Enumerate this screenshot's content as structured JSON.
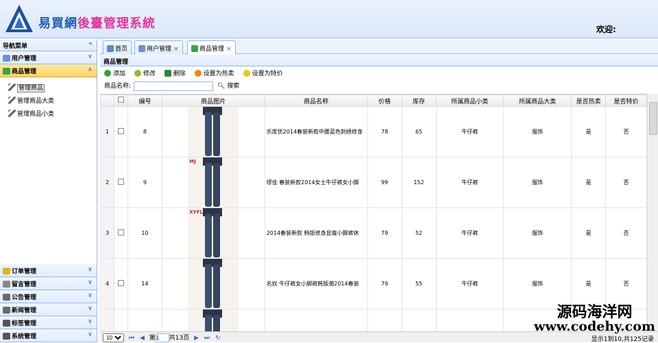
{
  "header": {
    "logo_text_blue": "易買網",
    "logo_text_pink": "後臺管理系統",
    "welcome": "欢迎:"
  },
  "sidebar": {
    "title": "导航菜单",
    "collapse_glyph": "«",
    "groups": [
      {
        "label": "用户管理",
        "icon": "user-icon",
        "color": "#6c8fd8"
      },
      {
        "label": "商品管理",
        "icon": "goods-icon",
        "color": "#3aa24a",
        "active": true
      }
    ],
    "leaves": [
      {
        "label": "管理商品",
        "icon": "wrench-icon",
        "selected": true
      },
      {
        "label": "管理商品大类",
        "icon": "wrench-icon"
      },
      {
        "label": "管理商品小类",
        "icon": "wrench-icon"
      }
    ],
    "bottom_groups": [
      {
        "label": "订单管理",
        "icon": "order-icon",
        "color": "#e0b224"
      },
      {
        "label": "留言管理",
        "icon": "message-icon",
        "color": "#888"
      },
      {
        "label": "公告管理",
        "icon": "notice-icon",
        "color": "#6a6a6a"
      },
      {
        "label": "新闻管理",
        "icon": "news-icon",
        "color": "#6a6a6a"
      },
      {
        "label": "标签管理",
        "icon": "tag-icon",
        "color": "#555"
      },
      {
        "label": "系统管理",
        "icon": "system-icon",
        "color": "#555"
      }
    ],
    "chevron": "∨"
  },
  "tabs": [
    {
      "label": "首页",
      "icon": "home-icon",
      "closable": false
    },
    {
      "label": "用户管理",
      "icon": "user-icon",
      "closable": true
    },
    {
      "label": "商品管理",
      "icon": "goods-icon",
      "closable": true,
      "active": true
    }
  ],
  "close_glyph": "×",
  "panel_title": "商品管理",
  "toolbar": [
    {
      "label": "添加",
      "icon": "add-icon",
      "color": "#35a33f"
    },
    {
      "label": "修改",
      "icon": "edit-icon",
      "color": "#8bbf33"
    },
    {
      "label": "删除",
      "icon": "delete-icon",
      "color": "#2f8a2f"
    },
    {
      "label": "设置为热卖",
      "icon": "fire-icon",
      "color": "#f08a10"
    },
    {
      "label": "设置为特价",
      "icon": "star-icon",
      "color": "#f2c40b"
    }
  ],
  "search": {
    "label": "商品名称:",
    "value": "",
    "button": "搜索"
  },
  "columns": [
    "",
    "编号",
    "商品图片",
    "商品名称",
    "价格",
    "库存",
    "所属商品小类",
    "所属商品大类",
    "是否热卖",
    "是否特价"
  ],
  "rows": [
    {
      "rn": "1",
      "id": "8",
      "tag": "",
      "name": "乐库优2014春装新款中腰蓝色刺绣修身",
      "price": "78",
      "stock": "65",
      "small": "牛仔裤",
      "big": "服饰",
      "hot": "是",
      "special": "否"
    },
    {
      "rn": "2",
      "id": "9",
      "tag": "MJ",
      "name": "缪佳 春装新款2014女士牛仔裤女小脚",
      "price": "99",
      "stock": "152",
      "small": "牛仔裤",
      "big": "服饰",
      "hot": "是",
      "special": "否"
    },
    {
      "rn": "3",
      "id": "10",
      "tag": "XYFL",
      "name": "2014春装新款 韩版修身显瘦小脚裤休",
      "price": "79",
      "stock": "52",
      "small": "牛仔裤",
      "big": "服饰",
      "hot": "是",
      "special": "否"
    },
    {
      "rn": "4",
      "id": "14",
      "tag": "",
      "name": "名奴 牛仔裤女小脚裤韩版潮2014春装",
      "price": "79",
      "stock": "55",
      "small": "牛仔裤",
      "big": "服饰",
      "hot": "是",
      "special": "否"
    },
    {
      "rn": "",
      "id": "",
      "tag": "",
      "name": "",
      "price": "",
      "stock": "",
      "small": "",
      "big": "",
      "hot": "",
      "special": ""
    }
  ],
  "pager": {
    "page_size": "10",
    "page_label": "第",
    "page_value": "1",
    "total_pages": "共13页",
    "info": "显示1到10,共125记录"
  },
  "watermark": {
    "line1": "源码海洋网",
    "line2": "www.codehy.com"
  }
}
